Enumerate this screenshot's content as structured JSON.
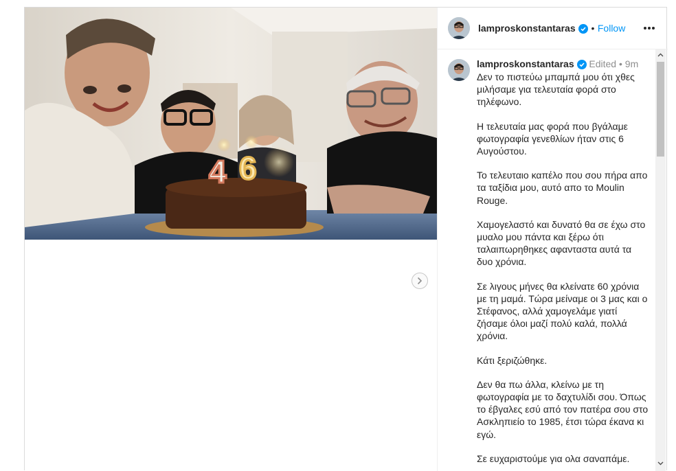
{
  "post": {
    "username": "lamproskonstantaras",
    "follow_label": "Follow",
    "dot": "•",
    "edited_label": "Edited",
    "time": "9m",
    "caption_paragraphs": [
      "Δεν το πιστεύω μπαμπά μου ότι χθες μιλήσαμε για τελευταία φορά στο τηλέφωνο.",
      "Η τελευταία μας φορά που βγάλαμε φωτογραφία γενεθλίων ήταν στις 6 Αυγούστου.",
      "Το τελευταιο καπέλο που σου πήρα απο τα ταξίδια μου, αυτό απο το Moulin Rouge.",
      "Χαμογελαστό και δυνατό θα σε έχω στο μυαλο μου πάντα και ξέρω ότι ταλαιπωρηθηκες αφανταστα αυτά τα δυο χρόνια.",
      "Σε λιγους μήνες θα κλείνατε 60 χρόνια με τη μαμά. Τώρα μείναμε οι 3 μας και ο Στέφανος, αλλά χαμογελάμε γιατί ζήσαμε όλοι μαζί πολύ καλά, πολλά χρόνια.",
      "Κάτι ξεριζώθηκε.",
      "Δεν θα πω άλλα, κλείνω με τη φωτογραφία με το δαχτυλίδι σου. Όπως το έβγαλες εσύ από τον πατέρα σου στο Ασκληπιείο το 1985, έτσι τώρα έκανα κι εγώ.",
      "Σε ευχαριστούμε για ολα σαναπάμε."
    ],
    "photo": {
      "candles": [
        "4",
        "6"
      ]
    }
  },
  "icons": {
    "verified": "verified-badge-icon",
    "more": "more-options-icon",
    "next": "chevron-right-icon"
  },
  "colors": {
    "accent": "#0095f6",
    "verified": "#0095f6",
    "text": "#262626",
    "muted": "#8e8e8e"
  }
}
